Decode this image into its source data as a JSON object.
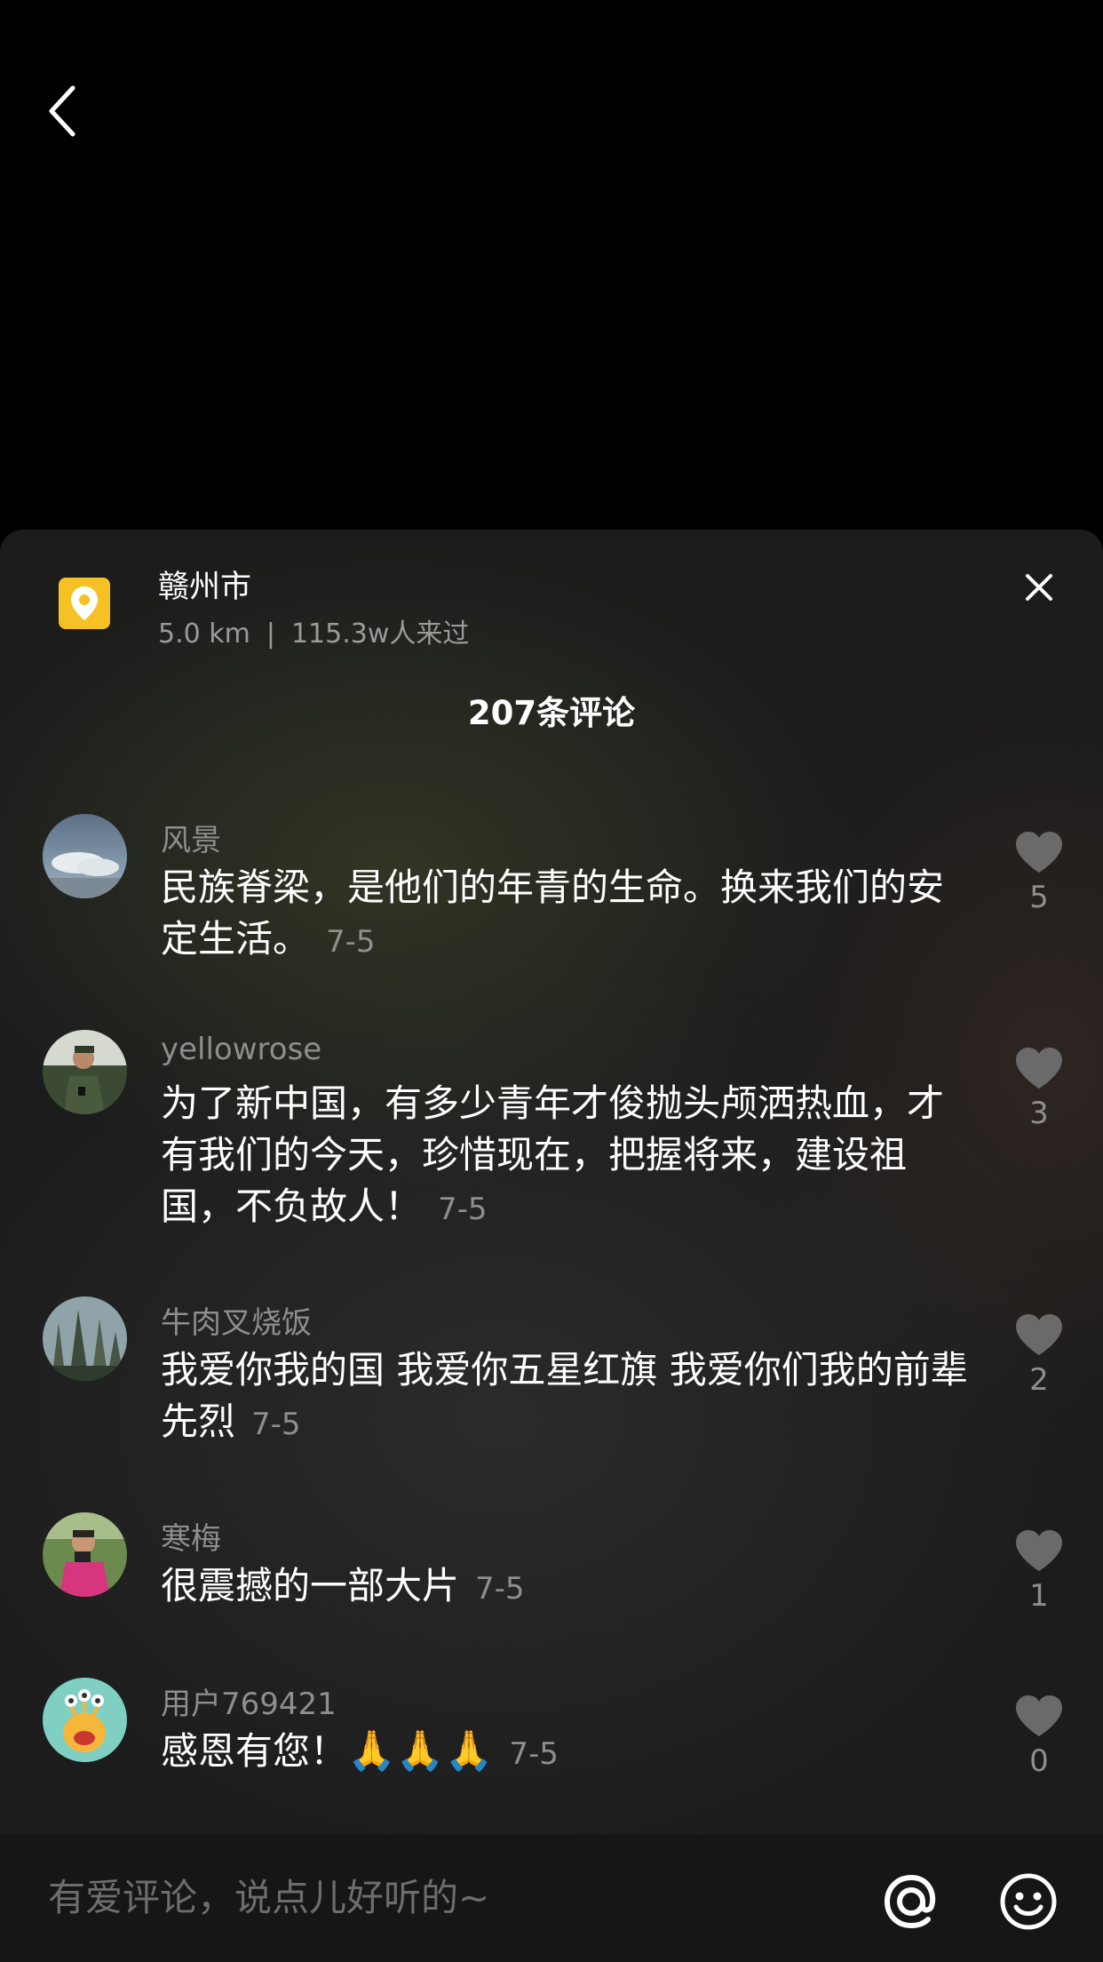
{
  "colors": {
    "background": "#000000",
    "sheet": "#1c1c1c",
    "location_icon": "#f6c125",
    "text_primary": "#ffffff",
    "text_secondary": "#8e8e8e",
    "heart": "#6a6a6a"
  },
  "icons": {
    "back": "chevron-left-icon",
    "location": "location-pin-icon",
    "close": "close-icon",
    "like": "heart-icon",
    "at": "at-sign-icon",
    "emoji": "smiley-icon"
  },
  "location": {
    "name": "赣州市",
    "distance": "5.0 km",
    "separator": "|",
    "visitors": "115.3w人来过"
  },
  "comment_count": "207条评论",
  "comments": [
    {
      "user": "风景",
      "text": "民族脊梁，是他们的年青的生命。换来我们的安定生活。",
      "date": "7-5",
      "likes": "5"
    },
    {
      "user": "yellowrose",
      "text": "为了新中国，有多少青年才俊抛头颅洒热血，才有我们的今天，珍惜现在，把握将来，建设祖国，不负故人！",
      "date": "7-5",
      "likes": "3"
    },
    {
      "user": "牛肉叉烧饭",
      "text": "我爱你我的国 我爱你五星红旗 我爱你们我的前辈先烈",
      "date": "7-5",
      "likes": "2"
    },
    {
      "user": "寒梅",
      "text": "很震撼的一部大片",
      "date": "7-5",
      "likes": "1"
    },
    {
      "user": "用户769421",
      "text": "感恩有您！",
      "emoji": "🙏🙏🙏",
      "date": "7-5",
      "likes": "0"
    }
  ],
  "input": {
    "placeholder": "有爱评论，说点儿好听的~"
  }
}
